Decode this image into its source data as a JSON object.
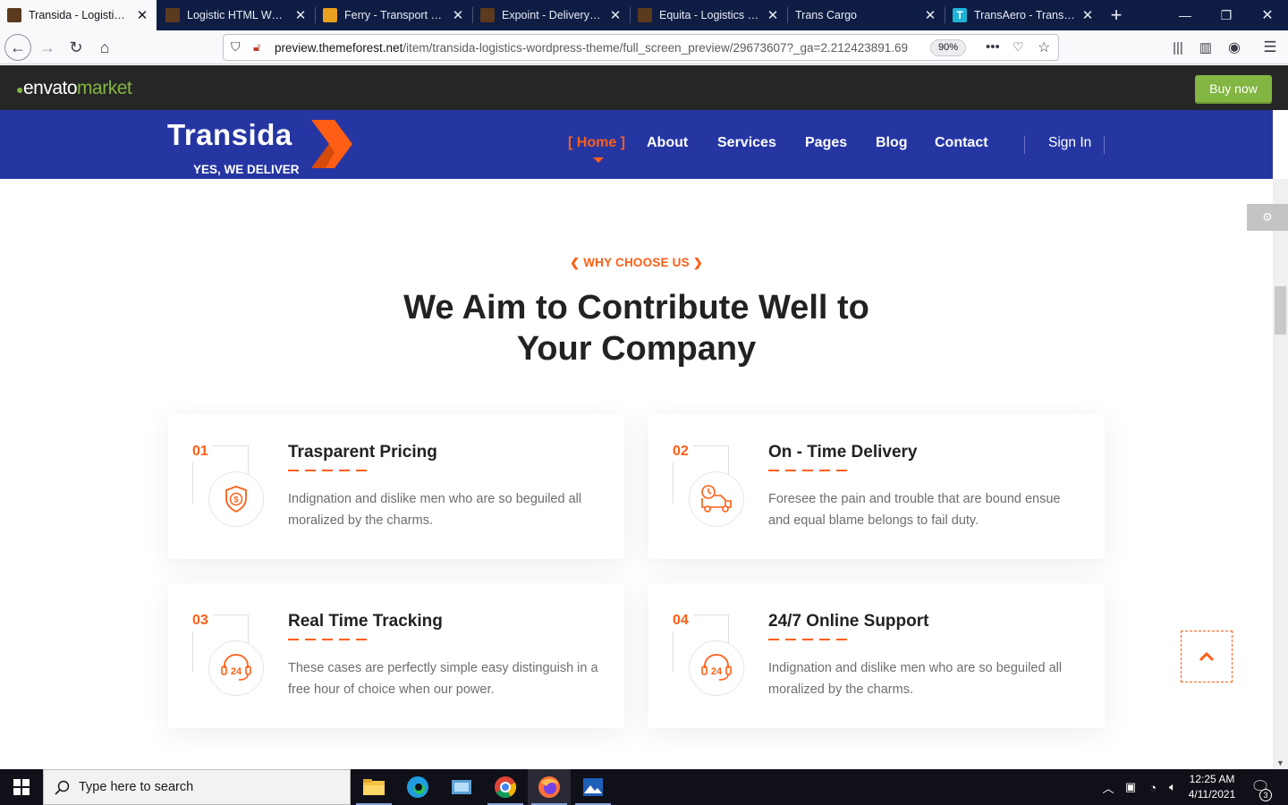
{
  "browser": {
    "tabs": [
      {
        "title": "Transida - Logistics W",
        "active": true,
        "favicon": "themeforest-icon"
      },
      {
        "title": "Logistic HTML Websit",
        "active": false,
        "favicon": "themeforest-icon"
      },
      {
        "title": "Ferry - Transport and L",
        "active": false,
        "favicon": "truck-icon"
      },
      {
        "title": "Expoint - Delivery Ser",
        "active": false,
        "favicon": "themeforest-icon"
      },
      {
        "title": "Equita - Logistics Carg",
        "active": false,
        "favicon": "themeforest-icon"
      },
      {
        "title": "Trans Cargo",
        "active": false,
        "favicon": ""
      },
      {
        "title": "TransAero - Transport",
        "active": false,
        "favicon": "t-letter-icon"
      }
    ],
    "url_host": "preview.themeforest.net",
    "url_path": "/item/transida-logistics-wordpress-theme/full_screen_preview/29673607?_ga=2.212423891.69",
    "zoom": "90%"
  },
  "envato": {
    "logo_main": "envato",
    "logo_market": "market",
    "buy_label": "Buy now"
  },
  "site": {
    "brand_name": "Transida",
    "brand_tagline": "YES, WE DELIVER",
    "nav": {
      "home": "[ Home ]",
      "about": "About",
      "services": "Services",
      "pages": "Pages",
      "blog": "Blog",
      "contact": "Contact",
      "signin": "Sign In"
    },
    "accent_color": "#ff5e14",
    "header_color": "#2536a3"
  },
  "section": {
    "eyebrow": "WHY CHOOSE US",
    "heading_line1": "We Aim to Contribute Well to",
    "heading_line2": "Your Company",
    "features": [
      {
        "num": "01",
        "title": "Trasparent Pricing",
        "desc": "Indignation and dislike men who are so beguiled all moralized by the charms.",
        "icon": "shield-dollar-icon"
      },
      {
        "num": "02",
        "title": "On - Time Delivery",
        "desc": "Foresee the pain and trouble that are bound ensue and equal blame belongs to fail duty.",
        "icon": "delivery-truck-clock-icon"
      },
      {
        "num": "03",
        "title": "Real Time Tracking",
        "desc": "These cases are perfectly simple easy distinguish in a free hour of choice when our power.",
        "icon": "support-24-icon"
      },
      {
        "num": "04",
        "title": "24/7 Online Support",
        "desc": "Indignation and dislike men who are so beguiled all moralized by the charms.",
        "icon": "support-24-icon"
      }
    ]
  },
  "taskbar": {
    "search_placeholder": "Type here to search",
    "time": "12:25 AM",
    "date": "4/11/2021",
    "notifications": "3"
  }
}
